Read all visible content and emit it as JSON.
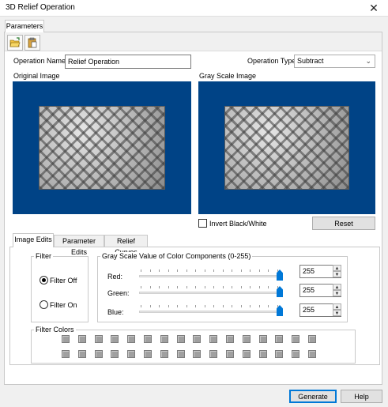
{
  "window": {
    "title": "3D Relief Operation",
    "close_label": "✕"
  },
  "outer_tab": "Parameters",
  "toolbar": {
    "buttons": [
      "open-folder-icon",
      "paste-icon"
    ]
  },
  "operation_name": {
    "label": "Operation Name:",
    "value": "Relief Operation"
  },
  "operation_type": {
    "label": "Operation Type:",
    "value": "Subtract"
  },
  "images": {
    "original_label": "Original Image",
    "grayscale_label": "Gray Scale Image",
    "frame_color": "#004386"
  },
  "invert": {
    "label": "Invert Black/White",
    "checked": false
  },
  "reset_label": "Reset",
  "inner_tabs": [
    "Image Edits",
    "Parameter Edits",
    "Relief Curves"
  ],
  "filter": {
    "title": "Filter",
    "off_label": "Filter Off",
    "on_label": "Filter On",
    "selected": "Filter Off"
  },
  "grayscale": {
    "title": "Gray Scale Value of Color Components (0-255)",
    "red": {
      "label": "Red:",
      "value": "255"
    },
    "green": {
      "label": "Green:",
      "value": "255"
    },
    "blue": {
      "label": "Blue:",
      "value": "255"
    }
  },
  "filter_colors": {
    "title": "Filter Colors",
    "rows": 2,
    "per_row": 16,
    "swatch_color": "#a0a0a0"
  },
  "footer": {
    "generate_label": "Generate",
    "help_label": "Help"
  }
}
